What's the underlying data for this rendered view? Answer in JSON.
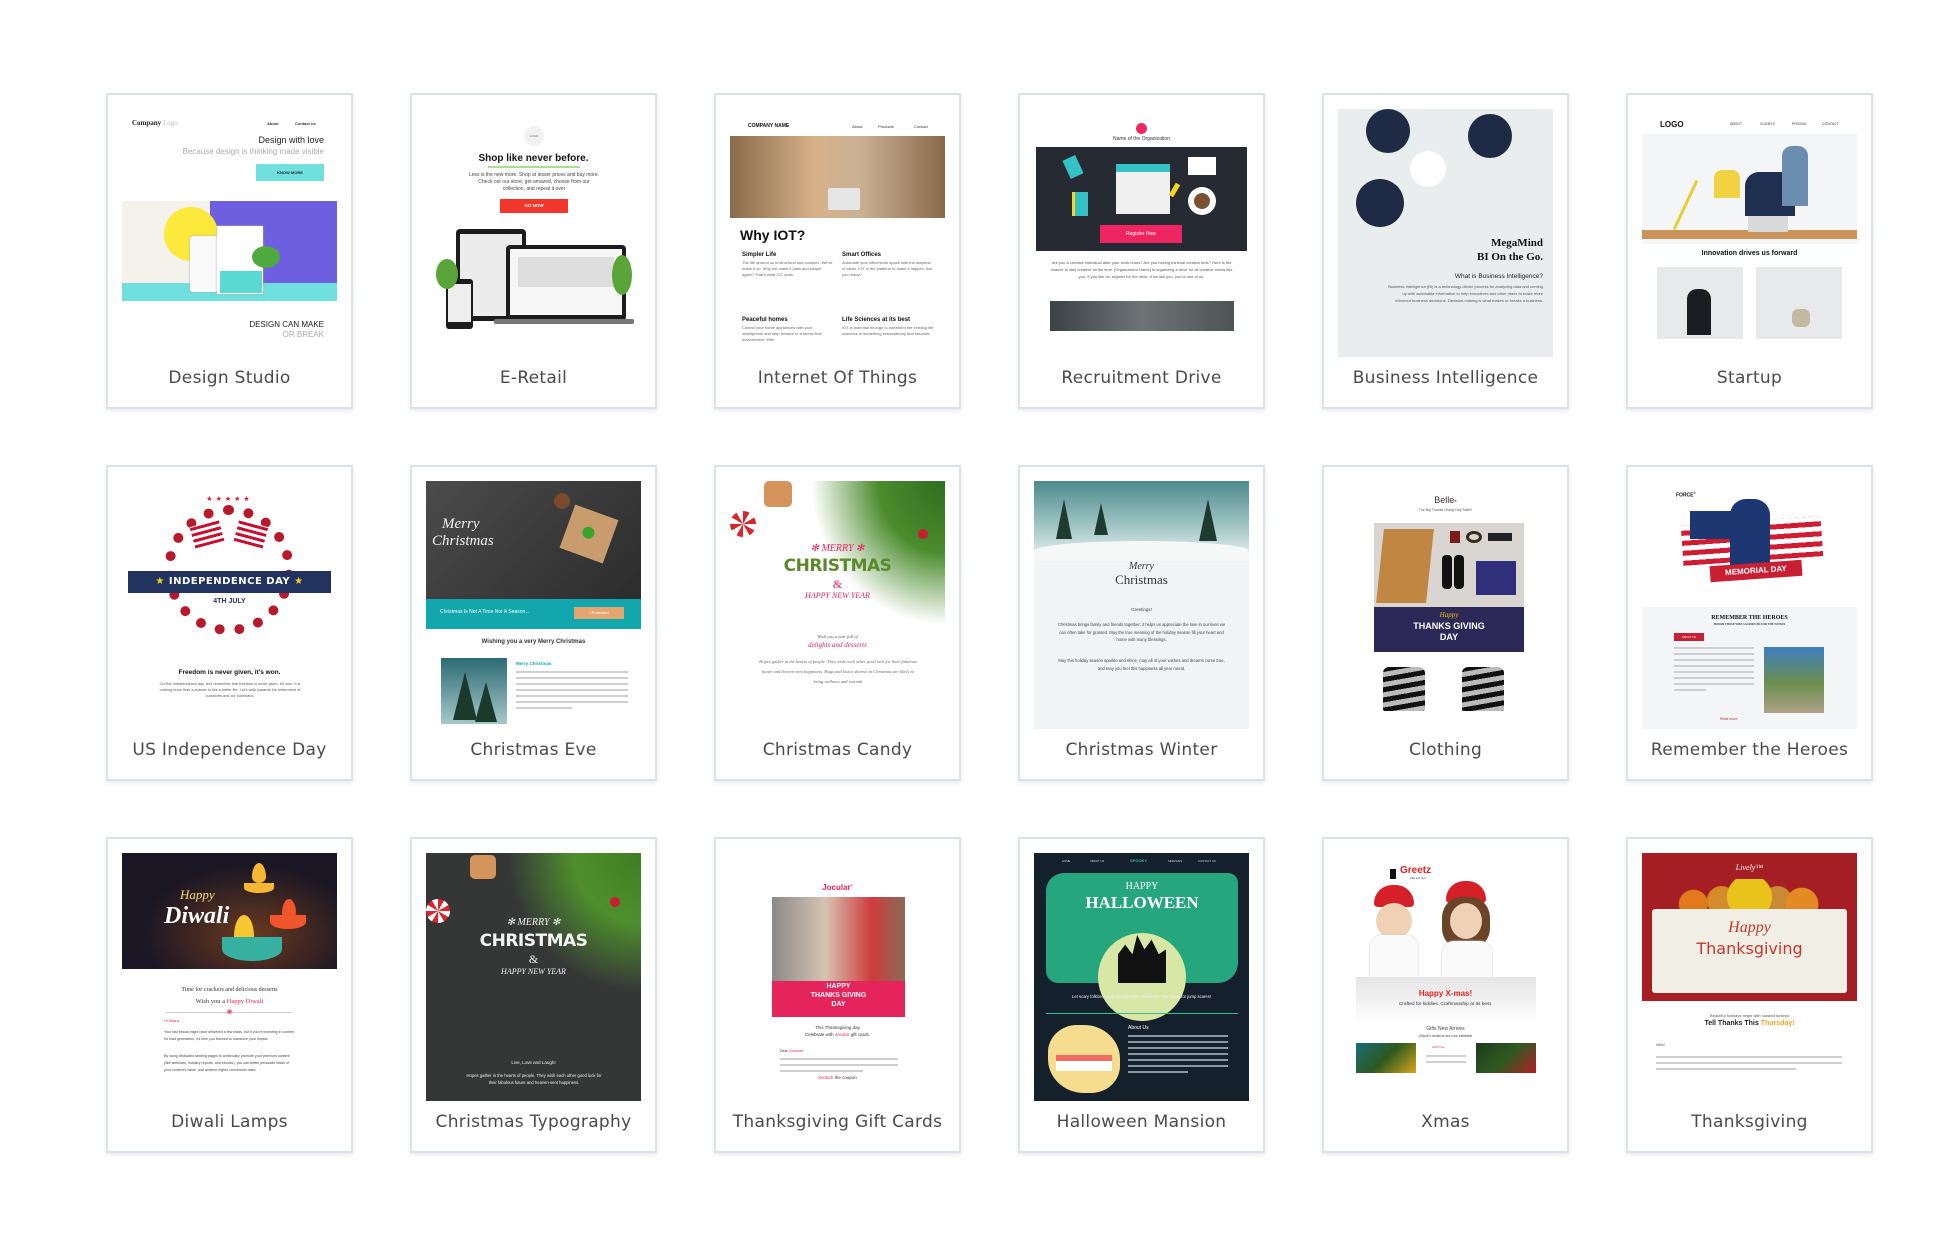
{
  "templates": [
    {
      "title": "Design Studio",
      "preview": {
        "logo": "Company",
        "logo_suffix": "Logo",
        "nav": [
          "About",
          "Contact us"
        ],
        "headline": "Design with love",
        "subline": "Because design is thinking made visible",
        "cta": "KNOW MORE",
        "footer_1": "DESIGN CAN MAKE",
        "footer_2": "OR BREAK"
      }
    },
    {
      "title": "E-Retail",
      "preview": {
        "logo": "LOGO",
        "headline": "Shop like never before.",
        "body": "Less is the new more. Shop at lesser prices and buy more. Check out our store, get amazed, choose from our collection, and repeat it over",
        "cta": "GO NOW"
      }
    },
    {
      "title": "Internet Of Things",
      "preview": {
        "company": "COMPANY NAME",
        "nav": [
          "About",
          "Products",
          "Contact"
        ],
        "headline": "Why IOT?",
        "sections": [
          {
            "h": "Simpler Life",
            "p": "The life around us is structural and complex. We've made it so. Why not make it plain and simple again? That's what IOT does."
          },
          {
            "h": "Smart Offices",
            "p": "Automate your office/work space with the simplest of ideas. IOT is the platform to make it happen. Are you ready?"
          },
          {
            "h": "Peaceful homes",
            "p": "Control your home appliances with your smartphone and step forward to a stress-free environment. With"
          },
          {
            "h": "Life Sciences at its best",
            "p": "IOT is potential enough to transform the existing life sciences to something extraordinary and futuristic"
          }
        ]
      }
    },
    {
      "title": "Recruitment Drive",
      "preview": {
        "org": "Name of the Organization",
        "cta": "Register Now",
        "body": "Are you a creative individual after your work hours? Are you having minimal creative time? Here is the chance to stay creative all the time. [Organization Name] is organizing a drive for all creative minds like you. If you like us, register for the drive. If we like you, you're one of us."
      }
    },
    {
      "title": "Business Intelligence",
      "preview": {
        "brand": "MegaMind",
        "tagline": "BI On the Go.",
        "question": "What is Business Intelligence?",
        "body": "Business Intelligence (BI) is a technology-driven process for analyzing data and coming up with actionable information to help executives and other users to make more informed business decisions. Decision-making is what makes or breaks a business."
      }
    },
    {
      "title": "Startup",
      "preview": {
        "logo": "LOGO",
        "nav": [
          "ABOUT",
          "CLIENTS",
          "PRICING",
          "CONTACT"
        ],
        "headline": "Innovation drives us forward"
      }
    },
    {
      "title": "US Independence Day",
      "preview": {
        "banner": "INDEPENDENCE DAY",
        "date": "4TH JULY",
        "headline": "Freedom is never given, it's won.",
        "body": "On this Independence day, let's remember that freedom is never given, it's won. It is nothing more than a chance to live a better life. Let's walk towards the betterment of ourselves and our homeland."
      }
    },
    {
      "title": "Christmas Eve",
      "preview": {
        "hero_1": "Merry",
        "hero_2": "Christmas",
        "strip": "Christmas Is Not A Time Nor A Season...",
        "strip_cta": "I Promised",
        "headline": "Wishing you a very Merry Christmas",
        "sub": "Merry Christmas"
      }
    },
    {
      "title": "Christmas Candy",
      "preview": {
        "merry": "MERRY",
        "christmas": "CHRISTMAS",
        "amp": "&",
        "new_year": "HAPPY NEW YEAR",
        "wish": "Wish you a year full of",
        "wish_accent": "delights and desserts",
        "body": "Hopes gather in the hearts of people. They wish each other good luck for their fabulous future and heaven-sent happiness. Hugs and kisses shared on Christmas are likely to bring wellness and warmth"
      }
    },
    {
      "title": "Christmas Winter",
      "preview": {
        "merry": "Merry",
        "christmas": "Christmas",
        "greeting": "Greetings!",
        "body_1": "Christmas brings family and friends together; it helps us appreciate the love in our lives we can often take for granted. May the true meaning of the holiday season fill your heart and home with many blessings.",
        "body_2": "May this holiday season sparkle and shine, may all of your wishes and dreams come true, and may you feel this happiness all year round."
      }
    },
    {
      "title": "Clothing",
      "preview": {
        "brand": "Belle",
        "tagline": "The Big Thanks Giving Day Sale!!!",
        "banner_1": "Happy",
        "banner_2": "THANKS GIVING",
        "banner_3": "DAY"
      }
    },
    {
      "title": "Remember the Heroes",
      "preview": {
        "brand": "FORCE",
        "banner": "MEMORIAL DAY",
        "headline": "REMEMBER THE HEROES",
        "sub": "HONOR THOSE WHO SACRIFICED FOR THE NATION",
        "tag": "ABOUT US",
        "link": "Read more"
      }
    },
    {
      "title": "Diwali Lamps",
      "preview": {
        "happy": "Happy",
        "diwali": "Diwali",
        "line_1": "Time for crackers  and delicious desserts",
        "line_2": "Wish you a",
        "line_2_accent": "Happy Diwali",
        "greet": "Hi Shara,",
        "body_1": "Your last ebook might have delivered a few leads, but if you're investing in content for lead generation, it's time you learned to maximize your impact.",
        "body_2": "By using dedicated landing pages to continually promote your premium content (like webinars, industry reports, and ebooks), you can better persuade leads of your content's value, and achieve higher conversion rates."
      }
    },
    {
      "title": "Christmas Typography",
      "preview": {
        "merry": "MERRY",
        "christmas": "CHRISTMAS",
        "amp": "&",
        "new_year": "HAPPY NEW YEAR",
        "tagline": "Live, Love and Laugh!",
        "body": "Hopes gather in the hearts of people. They wish each other good luck for their fabulous future and heaven-sent happiness."
      }
    },
    {
      "title": "Thanksgiving Gift Cards",
      "preview": {
        "brand": "Jocular",
        "banner_1": "HAPPY",
        "banner_2": "THANKS GIVING",
        "banner_3": "DAY",
        "line_1": "This Thanksgiving day",
        "line_2": "Celebrate with",
        "line_2_accent": "Jocular",
        "line_2_end": "gift cards.",
        "greet": "Dear",
        "greet_accent": "Customer",
        "cta_accent": "Scratch",
        "cta": "the coupon"
      }
    },
    {
      "title": "Halloween Mansion",
      "preview": {
        "nav": [
          "HOME",
          "ABOUT US",
          "SPOOKY",
          "SERVICES",
          "CONTACT US"
        ],
        "happy": "HAPPY",
        "halloween": "HALLOWEEN",
        "body": "Let scary folklores hug you tight this Halloween. Get ready for jump scares!",
        "about": "About Us"
      }
    },
    {
      "title": "Xmas",
      "preview": {
        "brand": "Greetz",
        "brand_sub": "Gifts and Toys",
        "headline": "Happy X-mas!",
        "tagline": "Crafted for kiddies. Craftmanship at its best.",
        "section": "Gifts New Arrives",
        "section_sub": "Lilliput's lanterns are now lullabies!",
        "item": "Gifts Two"
      }
    },
    {
      "title": "Thanksgiving",
      "preview": {
        "brand": "Lively",
        "happy": "Happy",
        "thanksgiving": "Thanksgiving",
        "sub": "Beautiful holidays begin with roasted turkeys",
        "headline": "Tell Thanks This",
        "headline_accent": "Thursday!",
        "greet": "Hello!"
      }
    }
  ],
  "colors": {
    "card_border": "#dbe3ea",
    "title_text": "#4a4a4a"
  }
}
